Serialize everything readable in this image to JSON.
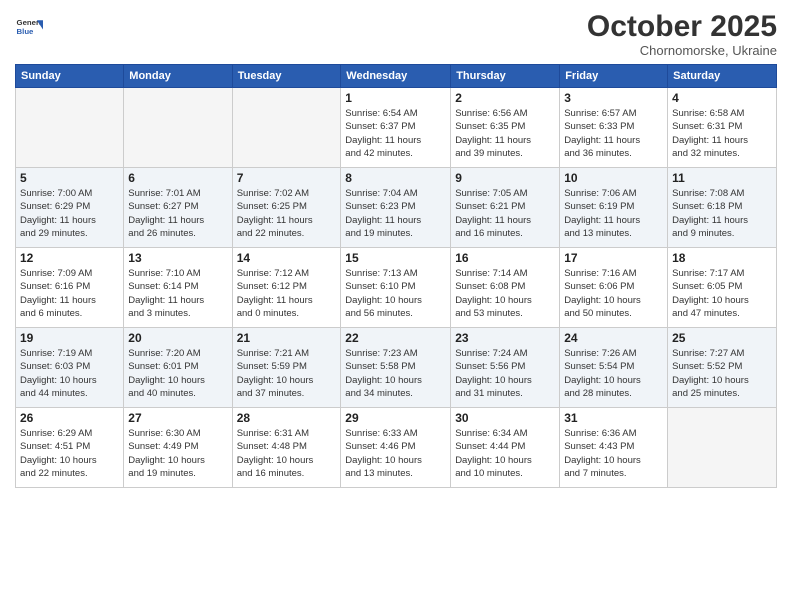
{
  "logo": {
    "line1": "General",
    "line2": "Blue"
  },
  "title": "October 2025",
  "subtitle": "Chornomorske, Ukraine",
  "weekdays": [
    "Sunday",
    "Monday",
    "Tuesday",
    "Wednesday",
    "Thursday",
    "Friday",
    "Saturday"
  ],
  "weeks": [
    [
      {
        "day": "",
        "info": ""
      },
      {
        "day": "",
        "info": ""
      },
      {
        "day": "",
        "info": ""
      },
      {
        "day": "1",
        "info": "Sunrise: 6:54 AM\nSunset: 6:37 PM\nDaylight: 11 hours\nand 42 minutes."
      },
      {
        "day": "2",
        "info": "Sunrise: 6:56 AM\nSunset: 6:35 PM\nDaylight: 11 hours\nand 39 minutes."
      },
      {
        "day": "3",
        "info": "Sunrise: 6:57 AM\nSunset: 6:33 PM\nDaylight: 11 hours\nand 36 minutes."
      },
      {
        "day": "4",
        "info": "Sunrise: 6:58 AM\nSunset: 6:31 PM\nDaylight: 11 hours\nand 32 minutes."
      }
    ],
    [
      {
        "day": "5",
        "info": "Sunrise: 7:00 AM\nSunset: 6:29 PM\nDaylight: 11 hours\nand 29 minutes."
      },
      {
        "day": "6",
        "info": "Sunrise: 7:01 AM\nSunset: 6:27 PM\nDaylight: 11 hours\nand 26 minutes."
      },
      {
        "day": "7",
        "info": "Sunrise: 7:02 AM\nSunset: 6:25 PM\nDaylight: 11 hours\nand 22 minutes."
      },
      {
        "day": "8",
        "info": "Sunrise: 7:04 AM\nSunset: 6:23 PM\nDaylight: 11 hours\nand 19 minutes."
      },
      {
        "day": "9",
        "info": "Sunrise: 7:05 AM\nSunset: 6:21 PM\nDaylight: 11 hours\nand 16 minutes."
      },
      {
        "day": "10",
        "info": "Sunrise: 7:06 AM\nSunset: 6:19 PM\nDaylight: 11 hours\nand 13 minutes."
      },
      {
        "day": "11",
        "info": "Sunrise: 7:08 AM\nSunset: 6:18 PM\nDaylight: 11 hours\nand 9 minutes."
      }
    ],
    [
      {
        "day": "12",
        "info": "Sunrise: 7:09 AM\nSunset: 6:16 PM\nDaylight: 11 hours\nand 6 minutes."
      },
      {
        "day": "13",
        "info": "Sunrise: 7:10 AM\nSunset: 6:14 PM\nDaylight: 11 hours\nand 3 minutes."
      },
      {
        "day": "14",
        "info": "Sunrise: 7:12 AM\nSunset: 6:12 PM\nDaylight: 11 hours\nand 0 minutes."
      },
      {
        "day": "15",
        "info": "Sunrise: 7:13 AM\nSunset: 6:10 PM\nDaylight: 10 hours\nand 56 minutes."
      },
      {
        "day": "16",
        "info": "Sunrise: 7:14 AM\nSunset: 6:08 PM\nDaylight: 10 hours\nand 53 minutes."
      },
      {
        "day": "17",
        "info": "Sunrise: 7:16 AM\nSunset: 6:06 PM\nDaylight: 10 hours\nand 50 minutes."
      },
      {
        "day": "18",
        "info": "Sunrise: 7:17 AM\nSunset: 6:05 PM\nDaylight: 10 hours\nand 47 minutes."
      }
    ],
    [
      {
        "day": "19",
        "info": "Sunrise: 7:19 AM\nSunset: 6:03 PM\nDaylight: 10 hours\nand 44 minutes."
      },
      {
        "day": "20",
        "info": "Sunrise: 7:20 AM\nSunset: 6:01 PM\nDaylight: 10 hours\nand 40 minutes."
      },
      {
        "day": "21",
        "info": "Sunrise: 7:21 AM\nSunset: 5:59 PM\nDaylight: 10 hours\nand 37 minutes."
      },
      {
        "day": "22",
        "info": "Sunrise: 7:23 AM\nSunset: 5:58 PM\nDaylight: 10 hours\nand 34 minutes."
      },
      {
        "day": "23",
        "info": "Sunrise: 7:24 AM\nSunset: 5:56 PM\nDaylight: 10 hours\nand 31 minutes."
      },
      {
        "day": "24",
        "info": "Sunrise: 7:26 AM\nSunset: 5:54 PM\nDaylight: 10 hours\nand 28 minutes."
      },
      {
        "day": "25",
        "info": "Sunrise: 7:27 AM\nSunset: 5:52 PM\nDaylight: 10 hours\nand 25 minutes."
      }
    ],
    [
      {
        "day": "26",
        "info": "Sunrise: 6:29 AM\nSunset: 4:51 PM\nDaylight: 10 hours\nand 22 minutes."
      },
      {
        "day": "27",
        "info": "Sunrise: 6:30 AM\nSunset: 4:49 PM\nDaylight: 10 hours\nand 19 minutes."
      },
      {
        "day": "28",
        "info": "Sunrise: 6:31 AM\nSunset: 4:48 PM\nDaylight: 10 hours\nand 16 minutes."
      },
      {
        "day": "29",
        "info": "Sunrise: 6:33 AM\nSunset: 4:46 PM\nDaylight: 10 hours\nand 13 minutes."
      },
      {
        "day": "30",
        "info": "Sunrise: 6:34 AM\nSunset: 4:44 PM\nDaylight: 10 hours\nand 10 minutes."
      },
      {
        "day": "31",
        "info": "Sunrise: 6:36 AM\nSunset: 4:43 PM\nDaylight: 10 hours\nand 7 minutes."
      },
      {
        "day": "",
        "info": ""
      }
    ]
  ]
}
